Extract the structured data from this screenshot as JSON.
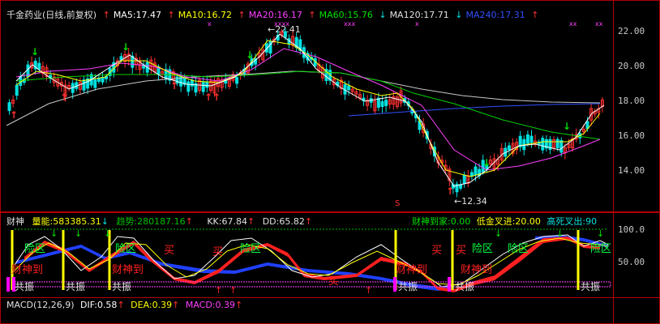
{
  "main_header": {
    "title": "千金药业(日线,前复权)",
    "ma5": "MA5:17.47",
    "ma10": "MA10:16.72",
    "ma20": "MA20:16.17",
    "ma60": "MA60:15.76",
    "ma120": "MA120:17.71",
    "ma240": "MA240:17.31"
  },
  "price_axis": {
    "ticks": [
      "22.00",
      "20.00",
      "18.00",
      "16.00",
      "14.00"
    ],
    "high_label": "←22.41",
    "low_label": "←12.34",
    "marker_s": "S"
  },
  "indicator_header": {
    "name": "财神",
    "energy": "量能:583385.31",
    "trend": "趋势:280187.16",
    "kk": "KK:67.84",
    "dd": "DD:65.82",
    "arrive": "财神到家:0.00",
    "low_cross": "低金叉进:20.00",
    "high_cross": "高死叉出:90"
  },
  "indicator_axis": {
    "ticks": [
      "100.0",
      "50.00"
    ]
  },
  "indicator_labels": {
    "god1": "财神到",
    "god2": "财神到",
    "god3": "财神到",
    "god4": "财神到",
    "buy1": "买",
    "buy2": "买",
    "buy3": "买",
    "buy4": "买",
    "buy5": "买",
    "risk1": "险区",
    "risk2": "险区",
    "risk3": "险区",
    "risk4": "险区",
    "risk5": "险区",
    "risk6": "险区",
    "resonance1": "共振",
    "resonance2": "共振",
    "resonance3": "共振",
    "resonance4": "共振",
    "resonance5": "共振",
    "resonance6": "共振"
  },
  "macd_header": {
    "name": "MACD(12,26,9)",
    "dif": "DIF:0.58",
    "dea": "DEA:0.39",
    "macd": "MACD:0.39"
  },
  "colors": {
    "ma5": "#ffffff",
    "ma10": "#ffff00",
    "ma20": "#ff00ff",
    "ma60": "#00e000",
    "ma120": "#d0d0d0",
    "ma240": "#3050ff",
    "up": "#ff3030",
    "down": "#00e0e0"
  }
}
